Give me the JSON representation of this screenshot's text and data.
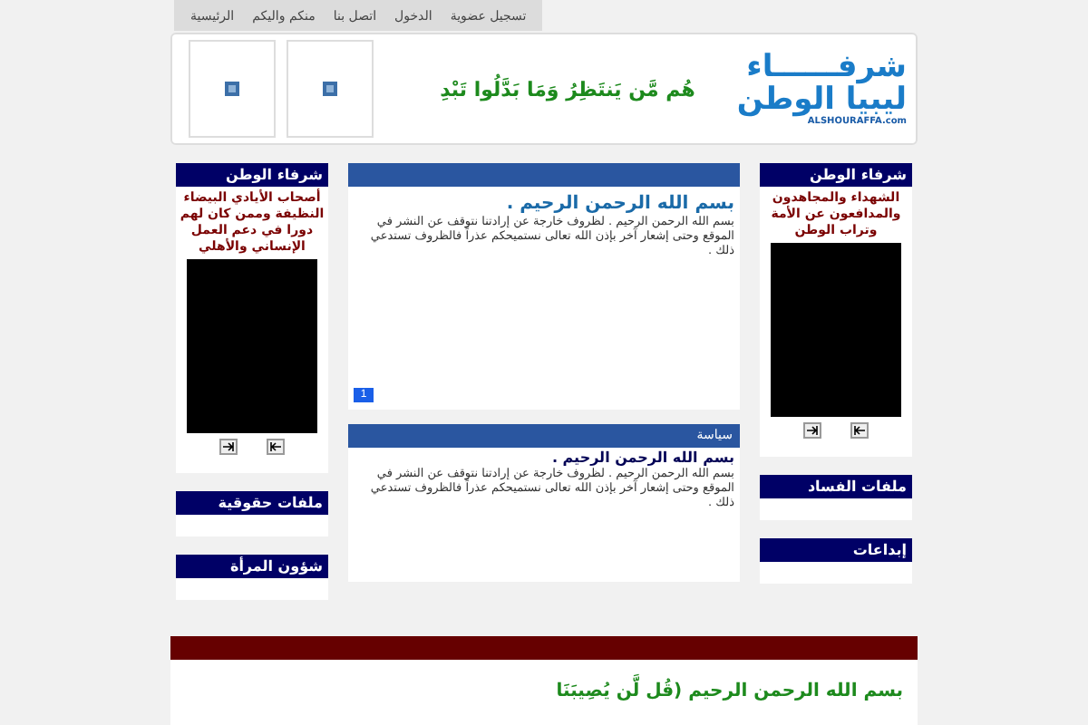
{
  "nav": [
    {
      "label": "تسجيل عضوية",
      "selected": false
    },
    {
      "label": "الدخول",
      "selected": false
    },
    {
      "label": "اتصل بنا",
      "selected": false
    },
    {
      "label": "منكم واليكم",
      "selected": false
    },
    {
      "label": "الرئيسية",
      "selected": false
    }
  ],
  "header": {
    "logo_top": "شرفــــــاء",
    "logo_bottom": "ليبيا الوطن",
    "logo_site": "ALSHOURAFFA.com",
    "verse": "هُم مَّن يَنتَظِرُ وَمَا بَدَّلُوا تَبْدِ"
  },
  "right_column": [
    {
      "kind": "video",
      "title": "شرفاء الوطن",
      "caption": "الشهداء والمجاهدون والمدافعون عن الأمة وتراب الوطن"
    },
    {
      "kind": "empty",
      "title": "ملفات الفساد"
    },
    {
      "kind": "empty",
      "title": "إبداعات"
    }
  ],
  "main": [
    {
      "title": "بسم الله الرحمن الرحيم .",
      "body": "بسم الله الرحمن الرحيم . لظروف خارجة عن إرادتنا  نتوقف عن النشر في الموقع  وحتى  إشعار آخر بإذن الله تعالى نستميحكم عذراً فالظروف تستدعي ذلك .",
      "pages": [
        {
          "label": "1",
          "selected": true
        }
      ]
    },
    {
      "header": "سياسة",
      "title": "بسم الله الرحمن الرحيم .",
      "body": "بسم الله الرحمن الرحيم . لظروف خارجة عن إرادتنا  نتوقف عن النشر في الموقع  وحتى  إشعار آخر بإذن الله تعالى نستميحكم عذراً فالظروف تستدعي ذلك ."
    }
  ],
  "left_column": [
    {
      "kind": "video",
      "title": "شرفاء الوطن",
      "caption": "أصحاب الأيادي البيضاء النظيفة وممن كان لهم دورا في دعم العمل الإنساني والأهلي"
    },
    {
      "kind": "empty",
      "title": "ملفات حقوقية"
    },
    {
      "kind": "empty",
      "title": "شؤون المرأة"
    }
  ],
  "footer": {
    "text": "بسم الله الرحمن الرحيم (قُل لَّن يُصِيبَنَا"
  }
}
